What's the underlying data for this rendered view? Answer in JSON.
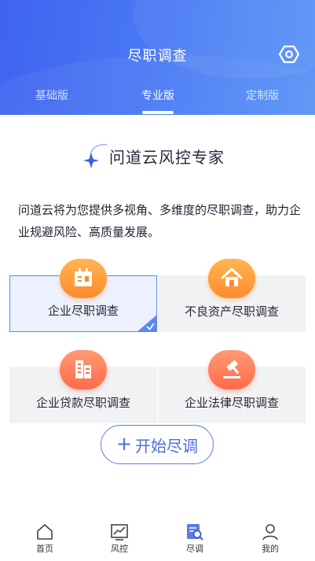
{
  "header": {
    "title": "尽职调查",
    "tabs": [
      {
        "label": "基础版",
        "active": false
      },
      {
        "label": "专业版",
        "active": true
      },
      {
        "label": "定制版",
        "active": false
      }
    ]
  },
  "brand": {
    "name": "问道云风控专家"
  },
  "description": "问道云将为您提供多视角、多维度的尽职调查，助力企业规避风险、高质量发展。",
  "services": [
    {
      "label": "企业尽职调查",
      "icon": "calendar-icon",
      "selected": true
    },
    {
      "label": "不良资产尽职调查",
      "icon": "house-icon",
      "selected": false
    },
    {
      "label": "企业贷款尽职调查",
      "icon": "building-icon",
      "selected": false
    },
    {
      "label": "企业法律尽职调查",
      "icon": "gavel-icon",
      "selected": false
    }
  ],
  "start_button": {
    "plus": "+",
    "label": "开始尽调"
  },
  "nav": [
    {
      "label": "首页",
      "icon": "home-icon"
    },
    {
      "label": "风控",
      "icon": "chart-icon"
    },
    {
      "label": "尽调",
      "icon": "search-doc-icon",
      "active": true
    },
    {
      "label": "我的",
      "icon": "user-icon"
    }
  ],
  "colors": {
    "header_start": "#3f63f0",
    "header_end": "#5a94f6",
    "accent": "#4a6fdc",
    "orange": "#ff8a2c",
    "red": "#ff6a4a"
  }
}
